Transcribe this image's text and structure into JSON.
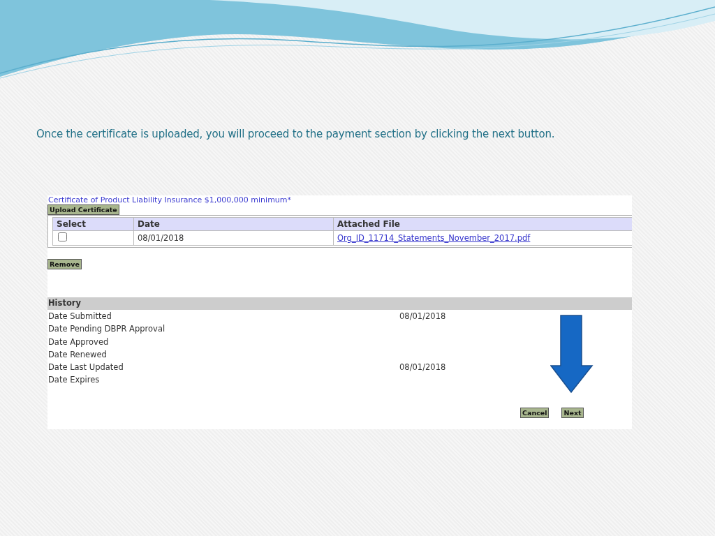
{
  "slide": {
    "caption": "Once the certificate is uploaded, you will proceed to the payment section by clicking the next button."
  },
  "form": {
    "heading": "Certificate of Product Liability Insurance $1,000,000 minimum*",
    "upload_button": "Upload Certificate",
    "table": {
      "columns": [
        "Select",
        "Date",
        "Attached File"
      ],
      "rows": [
        {
          "checked": false,
          "date": "08/01/2018",
          "file": "Org_ID_11714_Statements_November_2017.pdf"
        }
      ]
    },
    "remove_button": "Remove",
    "history": {
      "title": "History",
      "rows": [
        {
          "label": "Date Submitted",
          "value": "08/01/2018"
        },
        {
          "label": "Date Pending DBPR Approval"
        },
        {
          "label": "Date Approved"
        },
        {
          "label": "Date Renewed"
        },
        {
          "label": "Date Last Updated",
          "value": "08/01/2018"
        },
        {
          "label": "Date Expires"
        }
      ]
    },
    "buttons": [
      "Cancel",
      "Next"
    ]
  }
}
